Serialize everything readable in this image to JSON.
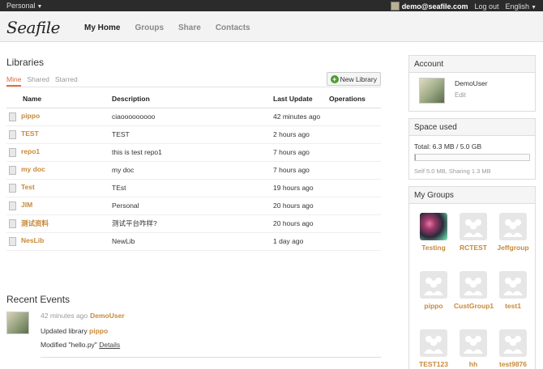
{
  "topbar": {
    "menu_label": "Personal",
    "user_email": "demo@seafile.com",
    "logout_label": "Log out",
    "language_label": "English"
  },
  "header": {
    "logo_text": "Seafile",
    "nav": [
      {
        "label": "My Home",
        "active": true
      },
      {
        "label": "Groups",
        "active": false
      },
      {
        "label": "Share",
        "active": false
      },
      {
        "label": "Contacts",
        "active": false
      }
    ]
  },
  "libraries": {
    "title": "Libraries",
    "tabs": [
      {
        "label": "Mine",
        "active": true
      },
      {
        "label": "Shared",
        "active": false
      },
      {
        "label": "Starred",
        "active": false
      }
    ],
    "new_button_label": "New Library",
    "columns": [
      "Name",
      "Description",
      "Last Update",
      "Operations"
    ],
    "rows": [
      {
        "name": "pippo",
        "description": "ciaooooooooo",
        "updated": "42 minutes ago"
      },
      {
        "name": "TEST",
        "description": "TEST",
        "updated": "2 hours ago"
      },
      {
        "name": "repo1",
        "description": "this is test repo1",
        "updated": "7 hours ago"
      },
      {
        "name": "my doc",
        "description": "my doc",
        "updated": "7 hours ago"
      },
      {
        "name": "Test",
        "description": "TEst",
        "updated": "19 hours ago"
      },
      {
        "name": "JIM",
        "description": "Personal",
        "updated": "20 hours ago"
      },
      {
        "name": "测试资料",
        "description": "测试平台咋样?",
        "updated": "20 hours ago"
      },
      {
        "name": "NesLib",
        "description": "NewLib",
        "updated": "1 day ago"
      }
    ]
  },
  "events": {
    "title": "Recent Events",
    "time": "42 minutes ago",
    "user": "DemoUser",
    "line1_prefix": "Updated library",
    "line1_link": "pippo",
    "line2_text": "Modified \"hello.py\"",
    "line2_link": "Details"
  },
  "account": {
    "title": "Account",
    "name": "DemoUser",
    "edit_label": "Edit"
  },
  "space": {
    "title": "Space used",
    "total": "Total: 6.3 MB / 5.0 GB",
    "used_fraction": 0.0013,
    "detail": "Self 5.0 MB, Sharing 1.3 MB"
  },
  "groups": {
    "title": "My Groups",
    "items": [
      {
        "name": "Testing",
        "photo": true
      },
      {
        "name": "RCTEST",
        "photo": false
      },
      {
        "name": "Jeffgroup",
        "photo": false
      },
      {
        "name": "pippo",
        "photo": false
      },
      {
        "name": "CustGroup1",
        "photo": false
      },
      {
        "name": "test1",
        "photo": false
      },
      {
        "name": "TEST123",
        "photo": false
      },
      {
        "name": "hh",
        "photo": false
      },
      {
        "name": "test9876",
        "photo": false
      }
    ]
  },
  "colors": {
    "link": "#c8893a",
    "accent_tab": "#d86a3a",
    "topbar_bg": "#2b2b2b"
  },
  "icons": [
    "caret-down-icon",
    "plus-icon",
    "library-icon",
    "group-people-icon"
  ]
}
